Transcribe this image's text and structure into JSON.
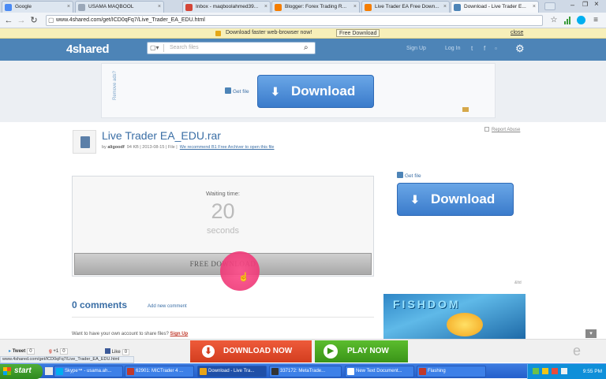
{
  "browser": {
    "tabs": [
      {
        "label": "Google",
        "icon": "google-icon",
        "color": "#4a8af4"
      },
      {
        "label": "USAMA MAQBOOL",
        "icon": "page-icon",
        "color": "#9aa7b8"
      },
      {
        "label": "Inbox - maqboolahmed39...",
        "icon": "gmail-icon",
        "color": "#d44638"
      },
      {
        "label": "Blogger: Forex Trading R...",
        "icon": "blogger-icon",
        "color": "#f57d00"
      },
      {
        "label": "Live Trader EA Free Down...",
        "icon": "blogger-icon",
        "color": "#f57d00"
      },
      {
        "label": "Download - Live Trader E...",
        "icon": "4shared-icon",
        "color": "#4d84b7"
      }
    ],
    "url": "www.4shared.com/get/ICD0qFq7/Live_Trader_EA_EDU.html",
    "infobar_text": "Download faster web-browser now!",
    "infobar_button": "Free Download",
    "infobar_close": "close"
  },
  "site": {
    "logo": "4shared",
    "search_placeholder": "Search files",
    "sign_up": "Sign Up",
    "log_in": "Log In"
  },
  "banner": {
    "remove_ads": "Remove ads?",
    "get_file": "Get file",
    "download": "Download"
  },
  "file": {
    "title": "Live Trader EA_EDU.rar",
    "by": "by",
    "author": "aligoodf",
    "meta": "94 KB | 2013-08-15 | File |",
    "recommend": "We recommend B1 Free Archiver to open this file",
    "report_abuse": "Report Abuse"
  },
  "wait": {
    "label": "Waiting time:",
    "number": "20",
    "unit": "seconds",
    "button": "FREE DOWNLOAD"
  },
  "sidebar": {
    "get_file": "Get file",
    "download": "Download",
    "ad_label": "&ltd",
    "ad_title": "FISHDOM"
  },
  "comments": {
    "title": "0 comments",
    "add": "Add new comment",
    "want_account": "Want to have your own account to share files?",
    "sign_up": "Sign Up"
  },
  "bottombar": {
    "tweet": "Tweet",
    "tweet_count": "0",
    "gplus": "+1",
    "gplus_count": "0",
    "like": "Like",
    "like_count": "0",
    "download_now": "DOWNLOAD NOW",
    "play_now": "PLAY NOW",
    "status_url": "www.4shared.com/get/ICD0qFq7/Live_Trader_EA_EDU.html"
  },
  "taskbar": {
    "start": "start",
    "tasks": [
      {
        "label": "Skype™ - usama.ah...",
        "color": "#00aff0"
      },
      {
        "label": "62901: MICTrader 4 ...",
        "color": "#c0392b"
      },
      {
        "label": "Download - Live Tra...",
        "color": "#e8a317"
      },
      {
        "label": "337172: MetaTrade...",
        "color": "#333333"
      },
      {
        "label": "New Text Document...",
        "color": "#ffffff"
      },
      {
        "label": "Flashing",
        "color": "#c0392b"
      }
    ],
    "clock": "9:55 PM"
  }
}
